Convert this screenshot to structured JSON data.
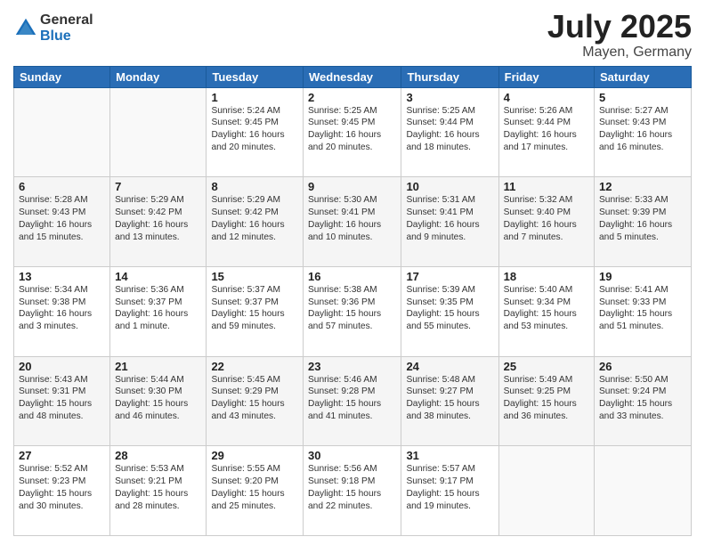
{
  "logo": {
    "general": "General",
    "blue": "Blue"
  },
  "title": "July 2025",
  "location": "Mayen, Germany",
  "days_header": [
    "Sunday",
    "Monday",
    "Tuesday",
    "Wednesday",
    "Thursday",
    "Friday",
    "Saturday"
  ],
  "weeks": [
    [
      {
        "day": "",
        "info": ""
      },
      {
        "day": "",
        "info": ""
      },
      {
        "day": "1",
        "info": "Sunrise: 5:24 AM\nSunset: 9:45 PM\nDaylight: 16 hours\nand 20 minutes."
      },
      {
        "day": "2",
        "info": "Sunrise: 5:25 AM\nSunset: 9:45 PM\nDaylight: 16 hours\nand 20 minutes."
      },
      {
        "day": "3",
        "info": "Sunrise: 5:25 AM\nSunset: 9:44 PM\nDaylight: 16 hours\nand 18 minutes."
      },
      {
        "day": "4",
        "info": "Sunrise: 5:26 AM\nSunset: 9:44 PM\nDaylight: 16 hours\nand 17 minutes."
      },
      {
        "day": "5",
        "info": "Sunrise: 5:27 AM\nSunset: 9:43 PM\nDaylight: 16 hours\nand 16 minutes."
      }
    ],
    [
      {
        "day": "6",
        "info": "Sunrise: 5:28 AM\nSunset: 9:43 PM\nDaylight: 16 hours\nand 15 minutes."
      },
      {
        "day": "7",
        "info": "Sunrise: 5:29 AM\nSunset: 9:42 PM\nDaylight: 16 hours\nand 13 minutes."
      },
      {
        "day": "8",
        "info": "Sunrise: 5:29 AM\nSunset: 9:42 PM\nDaylight: 16 hours\nand 12 minutes."
      },
      {
        "day": "9",
        "info": "Sunrise: 5:30 AM\nSunset: 9:41 PM\nDaylight: 16 hours\nand 10 minutes."
      },
      {
        "day": "10",
        "info": "Sunrise: 5:31 AM\nSunset: 9:41 PM\nDaylight: 16 hours\nand 9 minutes."
      },
      {
        "day": "11",
        "info": "Sunrise: 5:32 AM\nSunset: 9:40 PM\nDaylight: 16 hours\nand 7 minutes."
      },
      {
        "day": "12",
        "info": "Sunrise: 5:33 AM\nSunset: 9:39 PM\nDaylight: 16 hours\nand 5 minutes."
      }
    ],
    [
      {
        "day": "13",
        "info": "Sunrise: 5:34 AM\nSunset: 9:38 PM\nDaylight: 16 hours\nand 3 minutes."
      },
      {
        "day": "14",
        "info": "Sunrise: 5:36 AM\nSunset: 9:37 PM\nDaylight: 16 hours\nand 1 minute."
      },
      {
        "day": "15",
        "info": "Sunrise: 5:37 AM\nSunset: 9:37 PM\nDaylight: 15 hours\nand 59 minutes."
      },
      {
        "day": "16",
        "info": "Sunrise: 5:38 AM\nSunset: 9:36 PM\nDaylight: 15 hours\nand 57 minutes."
      },
      {
        "day": "17",
        "info": "Sunrise: 5:39 AM\nSunset: 9:35 PM\nDaylight: 15 hours\nand 55 minutes."
      },
      {
        "day": "18",
        "info": "Sunrise: 5:40 AM\nSunset: 9:34 PM\nDaylight: 15 hours\nand 53 minutes."
      },
      {
        "day": "19",
        "info": "Sunrise: 5:41 AM\nSunset: 9:33 PM\nDaylight: 15 hours\nand 51 minutes."
      }
    ],
    [
      {
        "day": "20",
        "info": "Sunrise: 5:43 AM\nSunset: 9:31 PM\nDaylight: 15 hours\nand 48 minutes."
      },
      {
        "day": "21",
        "info": "Sunrise: 5:44 AM\nSunset: 9:30 PM\nDaylight: 15 hours\nand 46 minutes."
      },
      {
        "day": "22",
        "info": "Sunrise: 5:45 AM\nSunset: 9:29 PM\nDaylight: 15 hours\nand 43 minutes."
      },
      {
        "day": "23",
        "info": "Sunrise: 5:46 AM\nSunset: 9:28 PM\nDaylight: 15 hours\nand 41 minutes."
      },
      {
        "day": "24",
        "info": "Sunrise: 5:48 AM\nSunset: 9:27 PM\nDaylight: 15 hours\nand 38 minutes."
      },
      {
        "day": "25",
        "info": "Sunrise: 5:49 AM\nSunset: 9:25 PM\nDaylight: 15 hours\nand 36 minutes."
      },
      {
        "day": "26",
        "info": "Sunrise: 5:50 AM\nSunset: 9:24 PM\nDaylight: 15 hours\nand 33 minutes."
      }
    ],
    [
      {
        "day": "27",
        "info": "Sunrise: 5:52 AM\nSunset: 9:23 PM\nDaylight: 15 hours\nand 30 minutes."
      },
      {
        "day": "28",
        "info": "Sunrise: 5:53 AM\nSunset: 9:21 PM\nDaylight: 15 hours\nand 28 minutes."
      },
      {
        "day": "29",
        "info": "Sunrise: 5:55 AM\nSunset: 9:20 PM\nDaylight: 15 hours\nand 25 minutes."
      },
      {
        "day": "30",
        "info": "Sunrise: 5:56 AM\nSunset: 9:18 PM\nDaylight: 15 hours\nand 22 minutes."
      },
      {
        "day": "31",
        "info": "Sunrise: 5:57 AM\nSunset: 9:17 PM\nDaylight: 15 hours\nand 19 minutes."
      },
      {
        "day": "",
        "info": ""
      },
      {
        "day": "",
        "info": ""
      }
    ]
  ]
}
